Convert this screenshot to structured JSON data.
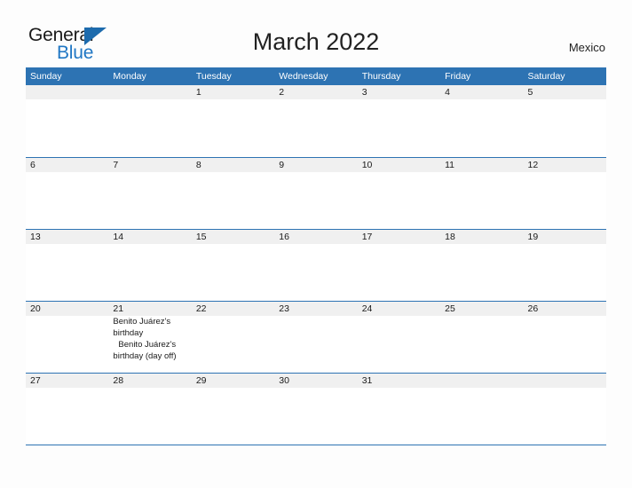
{
  "brand": {
    "name_part1": "General",
    "name_part2": "Blue",
    "triangle_icon": "triangle-logo-icon",
    "color_black": "#1a1a1a",
    "color_blue": "#2077c4"
  },
  "header": {
    "title": "March 2022",
    "region": "Mexico"
  },
  "theme": {
    "header_blue": "#2d73b3",
    "row_band_gray": "#f0f0f0",
    "page_background": "#fdfdfd",
    "text_dark": "#1a1a1a"
  },
  "calendar": {
    "month": "March",
    "year": "2022",
    "weekdays": [
      "Sunday",
      "Monday",
      "Tuesday",
      "Wednesday",
      "Thursday",
      "Friday",
      "Saturday"
    ],
    "weeks": [
      {
        "days": [
          {
            "num": "",
            "events": []
          },
          {
            "num": "",
            "events": []
          },
          {
            "num": "1",
            "events": []
          },
          {
            "num": "2",
            "events": []
          },
          {
            "num": "3",
            "events": []
          },
          {
            "num": "4",
            "events": []
          },
          {
            "num": "5",
            "events": []
          }
        ]
      },
      {
        "days": [
          {
            "num": "6",
            "events": []
          },
          {
            "num": "7",
            "events": []
          },
          {
            "num": "8",
            "events": []
          },
          {
            "num": "9",
            "events": []
          },
          {
            "num": "10",
            "events": []
          },
          {
            "num": "11",
            "events": []
          },
          {
            "num": "12",
            "events": []
          }
        ]
      },
      {
        "days": [
          {
            "num": "13",
            "events": []
          },
          {
            "num": "14",
            "events": []
          },
          {
            "num": "15",
            "events": []
          },
          {
            "num": "16",
            "events": []
          },
          {
            "num": "17",
            "events": []
          },
          {
            "num": "18",
            "events": []
          },
          {
            "num": "19",
            "events": []
          }
        ]
      },
      {
        "days": [
          {
            "num": "20",
            "events": []
          },
          {
            "num": "21",
            "events": [
              {
                "text": "Benito Juárez's birthday",
                "indent": false
              },
              {
                "text": "Benito Juárez's birthday (day off)",
                "indent": true
              }
            ]
          },
          {
            "num": "22",
            "events": []
          },
          {
            "num": "23",
            "events": []
          },
          {
            "num": "24",
            "events": []
          },
          {
            "num": "25",
            "events": []
          },
          {
            "num": "26",
            "events": []
          }
        ]
      },
      {
        "days": [
          {
            "num": "27",
            "events": []
          },
          {
            "num": "28",
            "events": []
          },
          {
            "num": "29",
            "events": []
          },
          {
            "num": "30",
            "events": []
          },
          {
            "num": "31",
            "events": []
          },
          {
            "num": "",
            "events": []
          },
          {
            "num": "",
            "events": []
          }
        ]
      }
    ]
  }
}
